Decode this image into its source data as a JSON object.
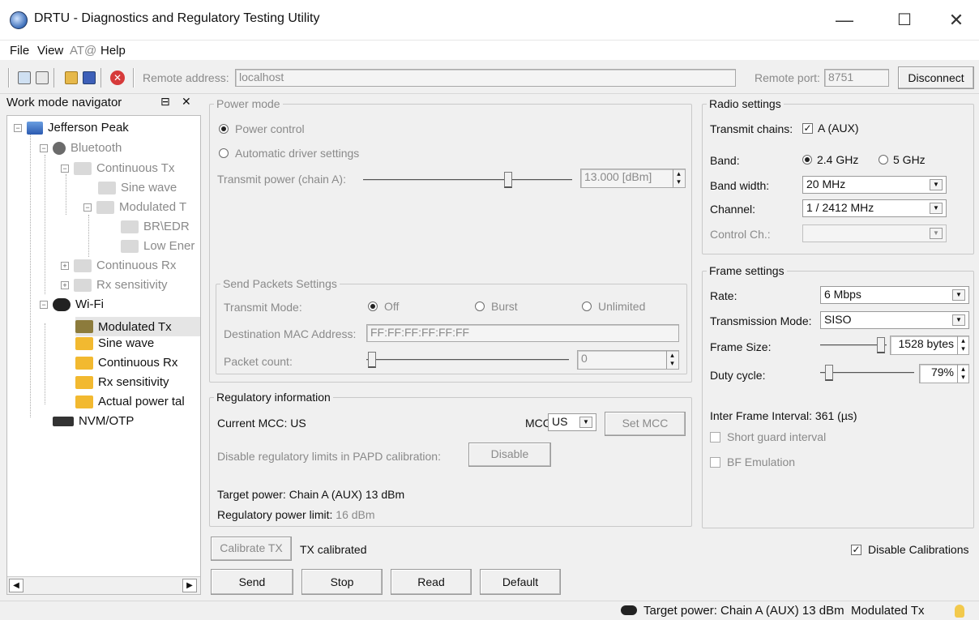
{
  "window": {
    "title": "DRTU - Diagnostics and Regulatory Testing Utility",
    "min_glyph": "—",
    "max_glyph": "☐",
    "close_glyph": "✕"
  },
  "menu": [
    "File",
    "View",
    "AT@",
    "Help"
  ],
  "toolbar": {
    "remote_address_label": "Remote address:",
    "remote_address_value": "localhost",
    "remote_port_label": "Remote port:",
    "remote_port_value": "8751",
    "disconnect_label": "Disconnect"
  },
  "nav": {
    "title": "Work mode navigator",
    "pin_glyph": "⊟",
    "close_glyph": "✕",
    "items": [
      {
        "label": "Jefferson Peak",
        "icon": "computer-icon"
      },
      {
        "label": "Bluetooth",
        "icon": "bluetooth-icon"
      },
      {
        "label": "Continuous Tx",
        "icon": "folder-icon"
      },
      {
        "label": "Sine wave",
        "icon": "folder-icon"
      },
      {
        "label": "Modulated T",
        "icon": "folder-icon"
      },
      {
        "label": "BR\\EDR",
        "icon": "folder-icon"
      },
      {
        "label": "Low Ener",
        "icon": "folder-icon"
      },
      {
        "label": "Continuous Rx",
        "icon": "folder-icon"
      },
      {
        "label": "Rx sensitivity",
        "icon": "folder-icon"
      },
      {
        "label": "Wi-Fi",
        "icon": "wifi-icon"
      },
      {
        "label": "Modulated Tx",
        "icon": "folder-icon"
      },
      {
        "label": "Sine wave",
        "icon": "folder-icon"
      },
      {
        "label": "Continuous Rx",
        "icon": "folder-icon"
      },
      {
        "label": "Rx sensitivity",
        "icon": "folder-icon"
      },
      {
        "label": "Actual power tal",
        "icon": "folder-icon"
      },
      {
        "label": "NVM/OTP",
        "icon": "chip-icon"
      }
    ]
  },
  "power_mode": {
    "group_label": "Power mode",
    "power_control": "Power control",
    "auto_driver": "Automatic driver settings",
    "transmit_power_label": "Transmit power (chain A):",
    "transmit_power_value": "13.000 [dBm]",
    "transmit_power_level": 0.7
  },
  "send_packets": {
    "group_label": "Send Packets Settings",
    "transmit_mode_label": "Transmit Mode:",
    "mode_off": "Off",
    "mode_burst": "Burst",
    "mode_unlimited": "Unlimited",
    "dest_mac_label": "Destination MAC Address:",
    "dest_mac_value": "FF:FF:FF:FF:FF:FF",
    "packet_count_label": "Packet count:",
    "packet_count_value": "0"
  },
  "regulatory": {
    "group_label": "Regulatory information",
    "current_mcc_label": "Current MCC:",
    "current_mcc_value": "US",
    "mcc_label": "MCC:",
    "mcc_value": "US",
    "set_mcc_label": "Set MCC",
    "disable_limits_label": "Disable regulatory limits in PAPD calibration:",
    "disable_label": "Disable",
    "target_power": "Target power: Chain A (AUX) 13 dBm",
    "reg_limit_label": "Regulatory power limit:",
    "reg_limit_value": "16 dBm"
  },
  "radio": {
    "group_label": "Radio settings",
    "transmit_chains_label": "Transmit chains:",
    "chain_a": "A (AUX)",
    "band_label": "Band:",
    "band_24": "2.4 GHz",
    "band_5": "5 GHz",
    "bandwidth_label": "Band width:",
    "bandwidth_value": "20 MHz",
    "channel_label": "Channel:",
    "channel_value": "1 / 2412 MHz",
    "control_ch_label": "Control Ch.:",
    "control_ch_value": ""
  },
  "frame": {
    "group_label": "Frame settings",
    "rate_label": "Rate:",
    "rate_value": "6 Mbps",
    "tx_mode_label": "Transmission Mode:",
    "tx_mode_value": "SISO",
    "frame_size_label": "Frame Size:",
    "frame_size_value": "1528 bytes",
    "frame_size_level": 0.95,
    "duty_cycle_label": "Duty cycle:",
    "duty_cycle_value": "79%",
    "duty_cycle_level": 0.1,
    "ifi": "Inter Frame Interval: 361 (µs)",
    "short_guard": "Short guard interval",
    "bf_emulation": "BF Emulation"
  },
  "bottom": {
    "calibrate_tx": "Calibrate TX",
    "tx_calibrated": "TX calibrated",
    "disable_calibrations": "Disable Calibrations",
    "send": "Send",
    "stop": "Stop",
    "read": "Read",
    "default": "Default"
  },
  "status": {
    "text": "Target power: Chain A (AUX) 13 dBm  Modulated Tx"
  }
}
